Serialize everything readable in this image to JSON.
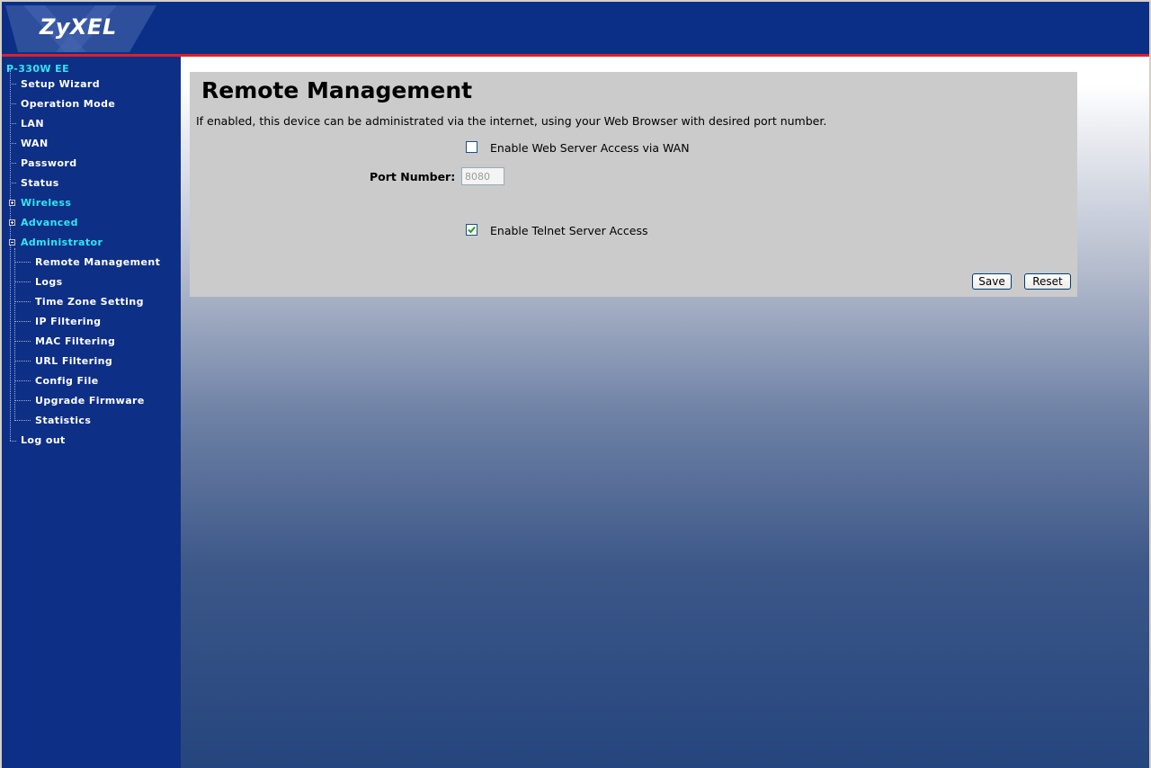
{
  "header": {
    "logo_text": "ZyXEL"
  },
  "sidebar": {
    "device": "P-330W EE",
    "items": [
      {
        "label": "Setup Wizard"
      },
      {
        "label": "Operation Mode"
      },
      {
        "label": "LAN"
      },
      {
        "label": "WAN"
      },
      {
        "label": "Password"
      },
      {
        "label": "Status"
      },
      {
        "label": "Wireless"
      },
      {
        "label": "Advanced"
      },
      {
        "label": "Administrator"
      }
    ],
    "admin_items": [
      {
        "label": "Remote Management"
      },
      {
        "label": "Logs"
      },
      {
        "label": "Time Zone Setting"
      },
      {
        "label": "IP Filtering"
      },
      {
        "label": "MAC Filtering"
      },
      {
        "label": "URL Filtering"
      },
      {
        "label": "Config File"
      },
      {
        "label": "Upgrade Firmware"
      },
      {
        "label": "Statistics"
      }
    ],
    "logout": "Log out"
  },
  "main": {
    "title": "Remote Management",
    "description": "If enabled, this device can be administrated via the internet, using your Web Browser with desired port number.",
    "web_access": {
      "label": "Enable Web Server Access via WAN",
      "checked": false
    },
    "port": {
      "label": "Port Number:",
      "value": "8080"
    },
    "telnet_access": {
      "label": "Enable Telnet Server Access",
      "checked": true
    },
    "save_label": "Save",
    "reset_label": "Reset"
  },
  "colors": {
    "header_bg": "#0b2f86",
    "accent_line": "#e0201e",
    "nav_highlight": "#2ee7f5",
    "panel_bg": "#cbcbcb"
  }
}
